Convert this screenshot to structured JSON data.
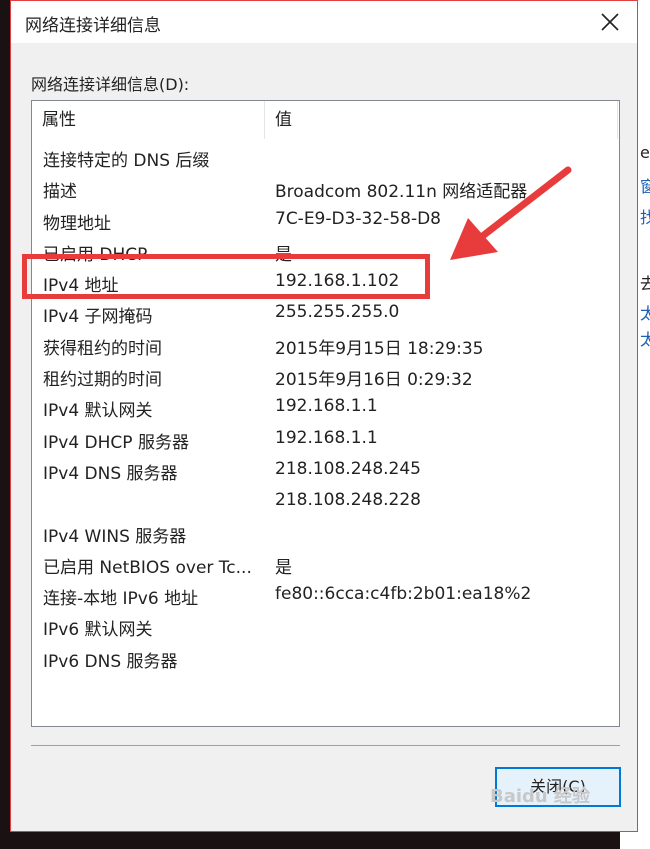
{
  "background_window": {
    "lines": [
      "e",
      "窗",
      "找",
      "去",
      "太",
      "太"
    ]
  },
  "dialog": {
    "title": "网络连接详细信息",
    "group_label": "网络连接详细信息(D):",
    "columns": {
      "property": "属性",
      "value": "值"
    },
    "rows": [
      {
        "property": "连接特定的 DNS 后缀",
        "value": ""
      },
      {
        "property": "描述",
        "value": "Broadcom 802.11n 网络适配器"
      },
      {
        "property": "物理地址",
        "value": "7C-E9-D3-32-58-D8"
      },
      {
        "property": "已启用 DHCP",
        "value": "是"
      },
      {
        "property": "IPv4 地址",
        "value": "192.168.1.102"
      },
      {
        "property": "IPv4 子网掩码",
        "value": "255.255.255.0"
      },
      {
        "property": "获得租约的时间",
        "value": "2015年9月15日 18:29:35"
      },
      {
        "property": "租约过期的时间",
        "value": "2015年9月16日 0:29:32"
      },
      {
        "property": "IPv4 默认网关",
        "value": "192.168.1.1"
      },
      {
        "property": "IPv4 DHCP 服务器",
        "value": "192.168.1.1"
      },
      {
        "property": "IPv4 DNS 服务器",
        "value": "218.108.248.245"
      },
      {
        "property": "",
        "value": "218.108.248.228"
      },
      {
        "property": "IPv4 WINS 服务器",
        "value": ""
      },
      {
        "property": "已启用 NetBIOS over Tc...",
        "value": "是"
      },
      {
        "property": "连接-本地 IPv6 地址",
        "value": "fe80::6cca:c4fb:2b01:ea18%2"
      },
      {
        "property": "IPv6 默认网关",
        "value": ""
      },
      {
        "property": "IPv6 DNS 服务器",
        "value": ""
      }
    ],
    "close_button": "关闭(C)",
    "highlighted_row": "IPv4 地址"
  },
  "watermark": {
    "text": "Baidu 经验"
  },
  "colors": {
    "highlight": "#e83c3c",
    "button_border": "#0078d7",
    "button_fill": "#e5f1fb"
  }
}
